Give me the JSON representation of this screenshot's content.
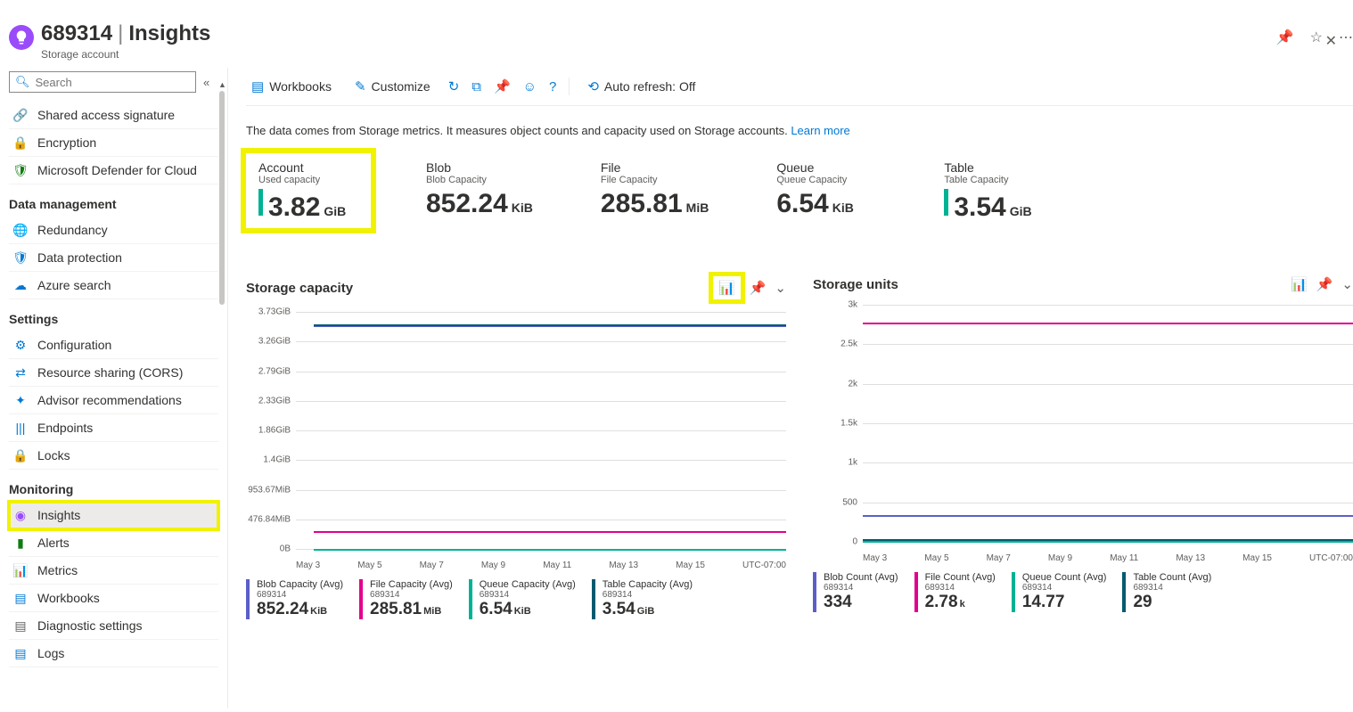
{
  "header": {
    "resource": "689314",
    "page": "Insights",
    "subtitle": "Storage account"
  },
  "search": {
    "placeholder": "Search"
  },
  "nav": {
    "top": [
      {
        "icon": "🔗",
        "label": "Shared access signature",
        "color": "#0078d4"
      },
      {
        "icon": "🔒",
        "label": "Encryption",
        "color": "#0078d4"
      },
      {
        "icon": "🛡",
        "label": "Microsoft Defender for Cloud",
        "color": "#107c10"
      }
    ],
    "sections": [
      {
        "title": "Data management",
        "items": [
          {
            "icon": "🌐",
            "label": "Redundancy",
            "color": "#0078d4"
          },
          {
            "icon": "🛡",
            "label": "Data protection",
            "color": "#0078d4"
          },
          {
            "icon": "☁",
            "label": "Azure search",
            "color": "#0078d4"
          }
        ]
      },
      {
        "title": "Settings",
        "items": [
          {
            "icon": "⚙",
            "label": "Configuration",
            "color": "#0078d4"
          },
          {
            "icon": "⇄",
            "label": "Resource sharing (CORS)",
            "color": "#0078d4"
          },
          {
            "icon": "✦",
            "label": "Advisor recommendations",
            "color": "#0078d4"
          },
          {
            "icon": "|||",
            "label": "Endpoints",
            "color": "#0078d4"
          },
          {
            "icon": "🔒",
            "label": "Locks",
            "color": "#605e5c"
          }
        ]
      },
      {
        "title": "Monitoring",
        "items": [
          {
            "icon": "◉",
            "label": "Insights",
            "active": true,
            "highlight": true,
            "color": "#9a4cfa"
          },
          {
            "icon": "▮",
            "label": "Alerts",
            "color": "#107c10"
          },
          {
            "icon": "📊",
            "label": "Metrics",
            "color": "#0078d4"
          },
          {
            "icon": "▤",
            "label": "Workbooks",
            "color": "#0078d4"
          },
          {
            "icon": "▤",
            "label": "Diagnostic settings",
            "color": "#605e5c"
          },
          {
            "icon": "▤",
            "label": "Logs",
            "color": "#0078d4"
          }
        ]
      }
    ]
  },
  "toolbar": {
    "workbooks": "Workbooks",
    "customize": "Customize",
    "autorefresh": "Auto refresh: Off"
  },
  "description": {
    "text": "The data comes from Storage metrics. It measures object counts and capacity used on Storage accounts. ",
    "link": "Learn more"
  },
  "tiles": [
    {
      "title": "Account",
      "sub": "Used capacity",
      "val": "3.82",
      "unit": "GiB",
      "bar": "#00b294",
      "highlight": true
    },
    {
      "title": "Blob",
      "sub": "Blob Capacity",
      "val": "852.24",
      "unit": "KiB"
    },
    {
      "title": "File",
      "sub": "File Capacity",
      "val": "285.81",
      "unit": "MiB"
    },
    {
      "title": "Queue",
      "sub": "Queue Capacity",
      "val": "6.54",
      "unit": "KiB"
    },
    {
      "title": "Table",
      "sub": "Table Capacity",
      "val": "3.54",
      "unit": "GiB",
      "bar": "#00b294"
    }
  ],
  "chart_data": [
    {
      "type": "line",
      "title": "Storage capacity",
      "x": [
        "May 3",
        "May 5",
        "May 7",
        "May 9",
        "May 11",
        "May 13",
        "May 15"
      ],
      "y_ticks": [
        "0B",
        "476.84MiB",
        "953.67MiB",
        "1.4GiB",
        "1.86GiB",
        "2.33GiB",
        "2.79GiB",
        "3.26GiB",
        "3.73GiB"
      ],
      "tz": "UTC-07:00",
      "series": [
        {
          "name": "Blob Capacity (Avg)",
          "src": "689314",
          "color": "#5b5fc7",
          "value": "852.24",
          "unit": "KiB",
          "level_gib": 3.52
        },
        {
          "name": "File Capacity (Avg)",
          "src": "689314",
          "color": "#e3008c",
          "value": "285.81",
          "unit": "MiB",
          "level_gib": 0.28
        },
        {
          "name": "Queue Capacity (Avg)",
          "src": "689314",
          "color": "#00b294",
          "value": "6.54",
          "unit": "KiB",
          "level_gib": 0.0
        },
        {
          "name": "Table Capacity (Avg)",
          "src": "689314",
          "color": "#005b70",
          "value": "3.54",
          "unit": "GiB",
          "level_gib": 3.54
        }
      ],
      "ylim": [
        0,
        3.73
      ],
      "highlight_action": true
    },
    {
      "type": "line",
      "title": "Storage units",
      "x": [
        "May 3",
        "May 5",
        "May 7",
        "May 9",
        "May 11",
        "May 13",
        "May 15"
      ],
      "y_ticks": [
        "0",
        "500",
        "1k",
        "1.5k",
        "2k",
        "2.5k",
        "3k"
      ],
      "tz": "UTC-07:00",
      "series": [
        {
          "name": "Blob Count (Avg)",
          "src": "689314",
          "color": "#5b5fc7",
          "value": "334",
          "unit": "",
          "level": 334
        },
        {
          "name": "File Count (Avg)",
          "src": "689314",
          "color": "#e3008c",
          "value": "2.78",
          "unit": "k",
          "level": 2780
        },
        {
          "name": "Queue Count (Avg)",
          "src": "689314",
          "color": "#00b294",
          "value": "14.77",
          "unit": "",
          "level": 14.77
        },
        {
          "name": "Table Count (Avg)",
          "src": "689314",
          "color": "#005b70",
          "value": "29",
          "unit": "",
          "level": 29
        }
      ],
      "ylim": [
        0,
        3000
      ]
    }
  ]
}
